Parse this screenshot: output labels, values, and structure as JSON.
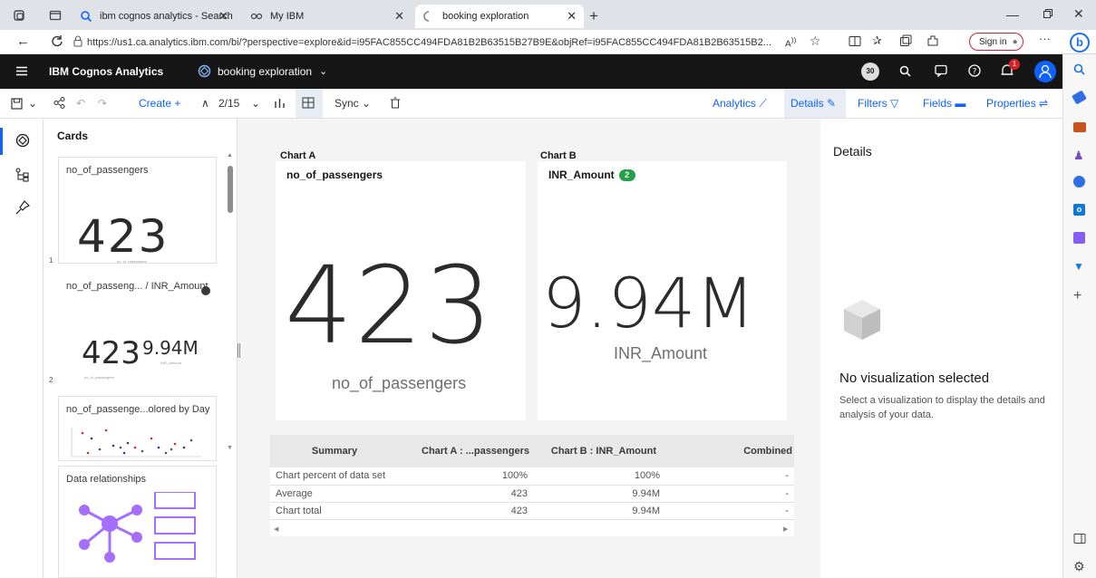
{
  "browser": {
    "tabs": [
      {
        "label": "ibm cognos analytics - Search"
      },
      {
        "label": "My IBM"
      },
      {
        "label": "booking exploration"
      }
    ],
    "url": "https://us1.ca.analytics.ibm.com/bi/?perspective=explore&id=i95FAC855CC494FDA81B2B63515B27B9E&objRef=i95FAC855CC494FDA81B2B63515B2...",
    "signin_label": "Sign in"
  },
  "app": {
    "brand": "IBM Cognos Analytics",
    "document": "booking exploration",
    "notification_count": "1"
  },
  "toolbar": {
    "create": "Create",
    "page_indicator": "2/15",
    "sync": "Sync",
    "analytics": "Analytics",
    "details": "Details",
    "filters": "Filters",
    "fields": "Fields",
    "properties": "Properties"
  },
  "cards_panel": {
    "title": "Cards",
    "cards": [
      {
        "title": "no_of_passengers",
        "number": "1",
        "value": "423",
        "caption": "no_of_passengers"
      },
      {
        "title": "no_of_passeng... / INR_Amount",
        "number": "2",
        "value_a": "423",
        "value_b": "9.94M",
        "caption_a": "no_of_passengers",
        "caption_b": "INR_Amount"
      },
      {
        "title": "no_of_passenge...olored by Day"
      },
      {
        "title": "Data relationships"
      }
    ]
  },
  "canvas": {
    "chart_a": {
      "header": "Chart A",
      "title": "no_of_passengers",
      "value": "423",
      "label": "no_of_passengers"
    },
    "chart_b": {
      "header": "Chart B",
      "title": "INR_Amount",
      "badge": "2",
      "value": "9.94M",
      "label": "INR_Amount"
    }
  },
  "summary": {
    "columns": [
      "Summary",
      "Chart A : ...passengers",
      "Chart B : INR_Amount",
      "Combined"
    ],
    "rows": [
      [
        "Chart percent of data set",
        "100%",
        "100%",
        "-"
      ],
      [
        "Average",
        "423",
        "9.94M",
        "-"
      ],
      [
        "Chart total",
        "423",
        "9.94M",
        "-"
      ]
    ]
  },
  "details_panel": {
    "title": "Details",
    "empty_title": "No visualization selected",
    "empty_desc": "Select a visualization to display the details and analysis of your data."
  },
  "colors": {
    "accent": "#0f62fe",
    "badge": "#24a148",
    "header_bg": "#161616",
    "relationship_purple": "#a56eff"
  }
}
